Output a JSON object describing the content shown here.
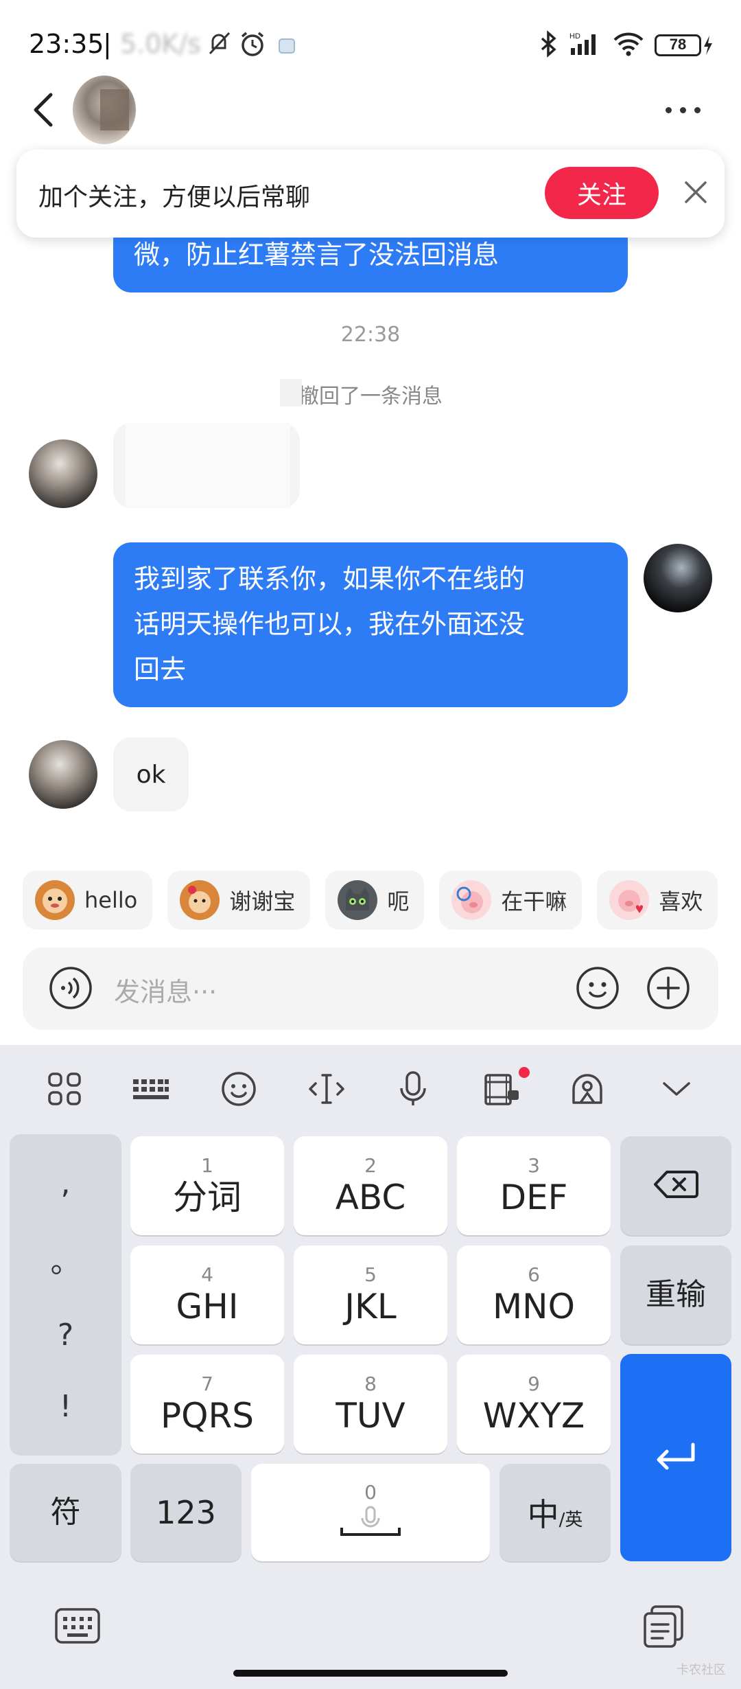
{
  "status_bar": {
    "time": "23:35",
    "separator": "|",
    "speed_obscured": "5.0K/s",
    "battery": "78"
  },
  "header": {
    "follow_prompt": "加个关注，方便以后常聊",
    "follow_button": "关注"
  },
  "messages": {
    "top_partial": "微，防止红薯禁言了没法回消息",
    "timestamp": "22:38",
    "recall_notice": "撤回了一条消息",
    "my_message": [
      "我到家了联系你，如果你不在线的",
      "话明天操作也可以，我在外面还没",
      "回去"
    ],
    "reply_ok": "ok"
  },
  "quick_replies": [
    {
      "label": "hello",
      "sticker": "monkey",
      "color": "#d9863a"
    },
    {
      "label": "谢谢宝",
      "sticker": "monkey-flower",
      "color": "#d9863a"
    },
    {
      "label": "呃",
      "sticker": "cat",
      "color": "#555a5e"
    },
    {
      "label": "在干嘛",
      "sticker": "pig-magnifier",
      "color": "#f1a3a8"
    },
    {
      "label": "喜欢",
      "sticker": "pig-heart",
      "color": "#f1a3a8"
    }
  ],
  "input": {
    "placeholder": "发消息···"
  },
  "keyboard": {
    "punct": [
      ",",
      "。",
      "?",
      "!"
    ],
    "rows": [
      [
        {
          "num": "1",
          "label": "分词"
        },
        {
          "num": "2",
          "label": "ABC"
        },
        {
          "num": "3",
          "label": "DEF"
        }
      ],
      [
        {
          "num": "4",
          "label": "GHI"
        },
        {
          "num": "5",
          "label": "JKL"
        },
        {
          "num": "6",
          "label": "MNO"
        }
      ],
      [
        {
          "num": "7",
          "label": "PQRS"
        },
        {
          "num": "8",
          "label": "TUV"
        },
        {
          "num": "9",
          "label": "WXYZ"
        }
      ]
    ],
    "reinput": "重输",
    "symbols": "符",
    "numbers": "123",
    "space_num": "0",
    "lang_main": "中",
    "lang_sub": "/英",
    "accent_color": "#1d6ff3"
  },
  "watermark": "卡农社区"
}
